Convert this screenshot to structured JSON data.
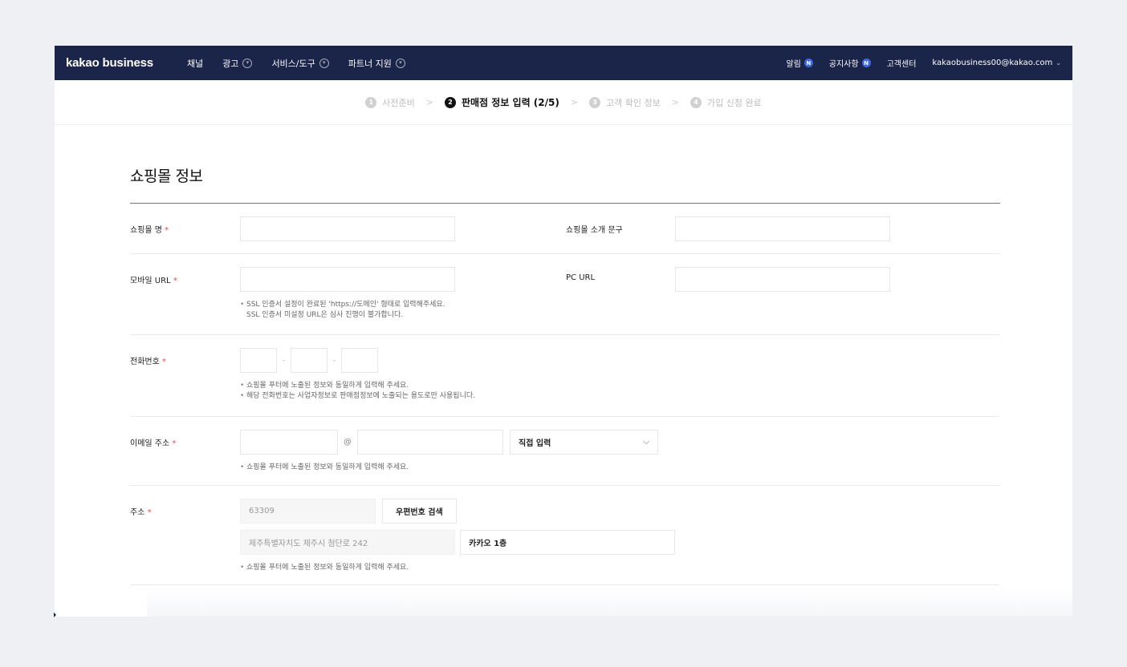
{
  "nav": {
    "logo": "kakao business",
    "items": [
      {
        "label": "채널",
        "has_dropdown": false
      },
      {
        "label": "광고",
        "has_dropdown": true
      },
      {
        "label": "서비스/도구",
        "has_dropdown": true
      },
      {
        "label": "파트너 지원",
        "has_dropdown": true
      }
    ],
    "right": {
      "alerts": "알림",
      "notices": "공지사항",
      "badge": "N",
      "support": "고객센터",
      "account": "kakaobusiness00@kakao.com"
    }
  },
  "steps": [
    {
      "num": "1",
      "label": "사전준비",
      "active": false
    },
    {
      "num": "2",
      "label": "판매점 정보 입력 (2/5)",
      "active": true
    },
    {
      "num": "3",
      "label": "고객 확인 정보",
      "active": false
    },
    {
      "num": "4",
      "label": "가입 신청 완료",
      "active": false
    }
  ],
  "step_separator": ">",
  "section": {
    "title": "쇼핑몰 정보"
  },
  "form": {
    "required_mark": "*",
    "mall_name": {
      "label": "쇼핑몰 명",
      "value": ""
    },
    "mall_intro": {
      "label": "쇼핑몰 소개 문구",
      "value": ""
    },
    "mobile_url": {
      "label": "모바일 URL",
      "value": "",
      "help": [
        "SSL 인증서 설정이 완료된 'https://도메인' 형태로 입력해주세요.",
        "SSL 인증서 미설정 URL은 심사 진행이 불가합니다."
      ]
    },
    "pc_url": {
      "label": "PC URL",
      "value": ""
    },
    "phone": {
      "label": "전화번호",
      "separator": "-",
      "help": [
        "쇼핑몰 푸터에 노출된 정보와 동일하게 입력해 주세요.",
        "해당 전화번호는 사업자정보로 판매점정보에 노출되는 용도로만 사용됩니다."
      ]
    },
    "email": {
      "label": "이메일 주소",
      "at": "@",
      "domain_option": "직접 입력",
      "help": [
        "쇼핑몰 푸터에 노출된 정보와 동일하게 입력해 주세요."
      ]
    },
    "address": {
      "label": "주소",
      "zipcode": "63309",
      "search_button": "우편번호 검색",
      "address1": "제주특별자치도 제주시 첨단로 242",
      "address2": "카카오 1층",
      "help": [
        "쇼핑몰 푸터에 노출된 정보와 동일하게 입력해 주세요."
      ]
    }
  }
}
